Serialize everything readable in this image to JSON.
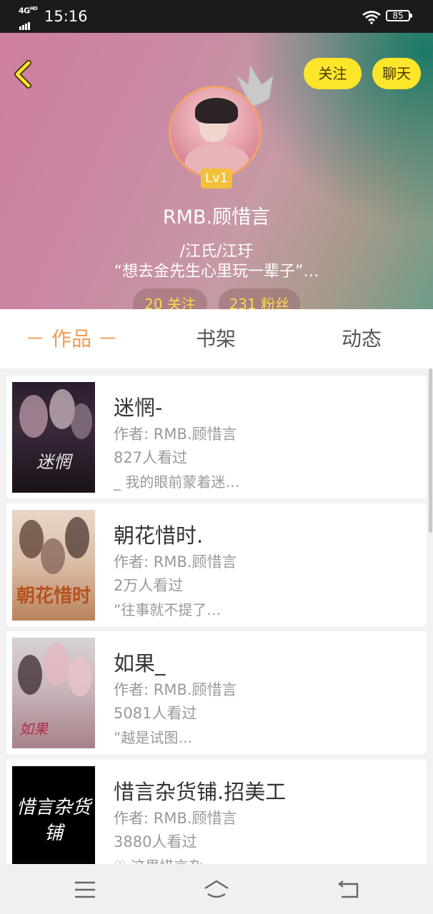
{
  "status_bar": {
    "network": "4G",
    "network_sup": "HD",
    "time": "15:16",
    "battery": "85"
  },
  "header": {
    "follow_label": "关注",
    "chat_label": "聊天",
    "level": "Lv1",
    "username": "RMB.顾惜言",
    "signature_line1": "/江氏/江玗",
    "signature_line2": "“想去金先生心里玩一辈子”…",
    "following_count": "20 关注",
    "fans_count": "231 粉丝"
  },
  "tabs": [
    {
      "label": "－ 作品 －",
      "active": true
    },
    {
      "label": "书架",
      "active": false
    },
    {
      "label": "动态",
      "active": false
    }
  ],
  "books": [
    {
      "title": "迷惘-",
      "author": "作者: RMB.顾惜言",
      "views": "827人看过",
      "snippet": "_ 我的眼前蒙着迷…",
      "cover_text": "迷惘"
    },
    {
      "title": "朝花惜时.",
      "author": "作者: RMB.顾惜言",
      "views": "2万人看过",
      "snippet": "“往事就不提了…",
      "cover_text": "朝花惜时"
    },
    {
      "title": "如果_",
      "author": "作者: RMB.顾惜言",
      "views": "5081人看过",
      "snippet": "“越是试图…",
      "cover_text": "如果"
    },
    {
      "title": "惜言杂货铺.招美工",
      "author": "作者: RMB.顾惜言",
      "views": "3880人看过",
      "snippet": "♡ 这里惜言杂",
      "cover_text": "惜言杂货铺"
    }
  ],
  "colors": {
    "accent": "#f59a52",
    "pill_yellow": "#fde52a",
    "level_badge": "#f4c03a"
  },
  "icons": [
    "back-icon",
    "crown-icon",
    "menu-icon",
    "home-icon",
    "return-icon",
    "wifi-icon",
    "battery-icon",
    "signal-icon"
  ]
}
